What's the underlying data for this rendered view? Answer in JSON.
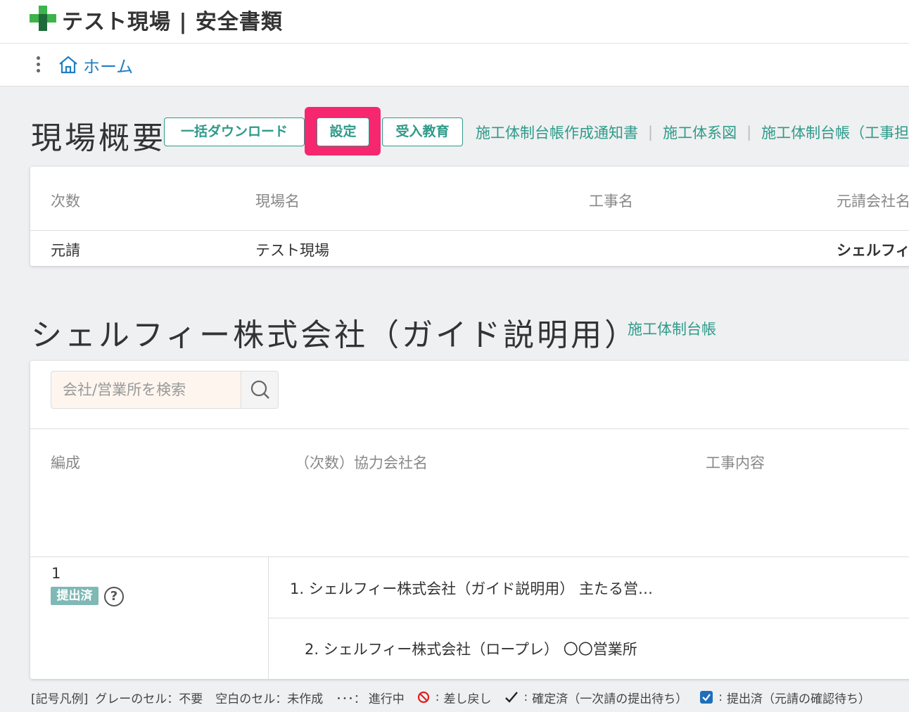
{
  "header": {
    "title": "テスト現場 | 安全書類"
  },
  "nav": {
    "home_label": "ホーム"
  },
  "overview": {
    "title": "現場概要",
    "buttons": {
      "bulk_download": "一括ダウンロード",
      "settings": "設定",
      "training": "受入教育"
    },
    "links": [
      "施工体制台帳作成通知書",
      "施工体系図",
      "施工体制台帳（工事担"
    ],
    "table": {
      "headers": [
        "次数",
        "現場名",
        "工事名",
        "元請会社名"
      ],
      "row": [
        "元請",
        "テスト現場",
        "",
        "シェルフィ"
      ]
    }
  },
  "company": {
    "title": "シェルフィー株式会社（ガイド説明用）",
    "link": "施工体制台帳",
    "search_placeholder": "会社/営業所を検索",
    "table": {
      "headers": [
        "編成",
        "（次数）協力会社名",
        "工事内容"
      ],
      "group_number": "1",
      "status_badge": "提出済",
      "help": "?",
      "rows": [
        "1. シェルフィー株式会社（ガイド説明用） 主たる営…",
        "2. シェルフィー株式会社（ロープレ） 〇〇営業所"
      ]
    }
  },
  "legend": {
    "title": "[記号凡例]",
    "gray_cell": "グレーのセル：不要",
    "blank_cell": "空白のセル：未作成",
    "in_progress_symbol": "･･･：",
    "in_progress": "進行中",
    "rejected": "差し戻し",
    "confirmed": "確定済（一次請の提出待ち）",
    "submitted": "提出済（元請の確認待ち）"
  },
  "colors": {
    "accent": "#2e9a8a",
    "link_blue": "#1f7fc4",
    "highlight": "#f6276e",
    "badge": "#7fb9b6",
    "logo_green": "#3cb44b",
    "logo_dark": "#1d6b3a"
  }
}
